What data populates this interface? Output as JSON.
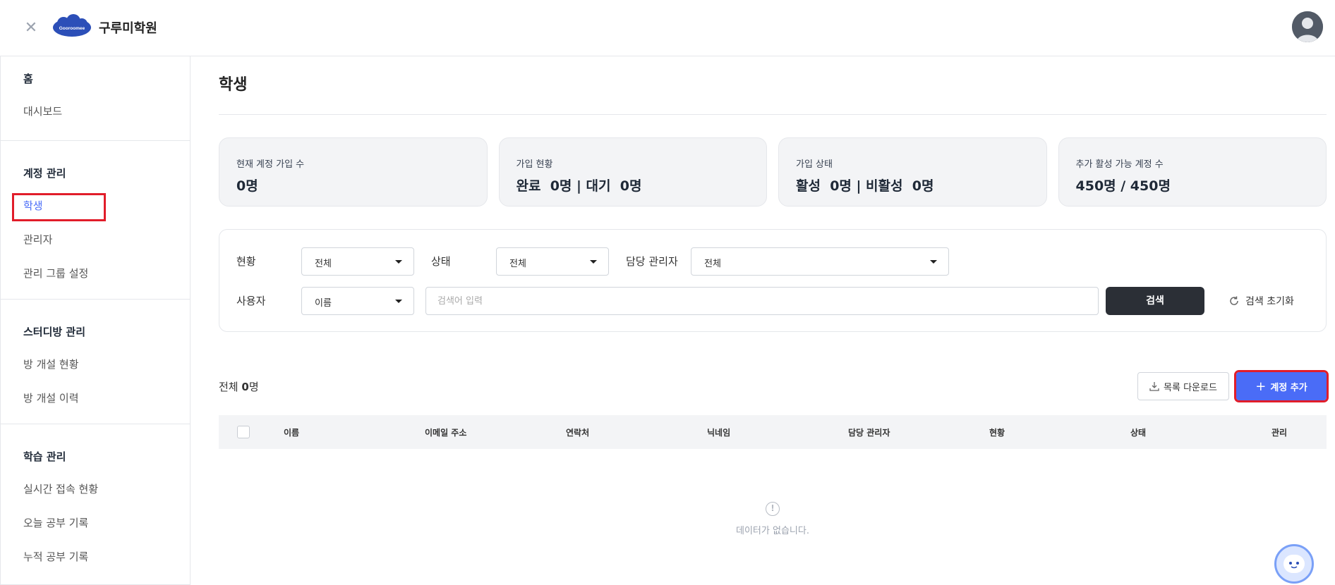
{
  "header": {
    "brand_name": "구루미학원",
    "logo_text": "Gooroomee"
  },
  "sidebar": {
    "sections": [
      {
        "heading": "홈",
        "items": [
          "대시보드"
        ]
      },
      {
        "heading": "계정 관리",
        "items": [
          "학생",
          "관리자",
          "관리 그룹 설정"
        ]
      },
      {
        "heading": "스터디방 관리",
        "items": [
          "방 개설 현황",
          "방 개설 이력"
        ]
      },
      {
        "heading": "학습 관리",
        "items": [
          "실시간 접속 현황",
          "오늘 공부 기록",
          "누적 공부 기록"
        ]
      }
    ],
    "active_item": "학생"
  },
  "page": {
    "title": "학생"
  },
  "stats": [
    {
      "label": "현재 계정 가입 수",
      "value": "0명"
    },
    {
      "label": "가입 현황",
      "value": "완료  0명 | 대기  0명"
    },
    {
      "label": "가입 상태",
      "value": "활성  0명 | 비활성  0명"
    },
    {
      "label": "추가 활성 가능 계정 수",
      "value": "450명 / 450명"
    }
  ],
  "filters": {
    "status_label": "현황",
    "status_value": "전체",
    "state_label": "상태",
    "state_value": "전체",
    "manager_label": "담당 관리자",
    "manager_value": "전체",
    "user_label": "사용자",
    "user_field_value": "이름",
    "search_placeholder": "검색어 입력",
    "search_button": "검색",
    "reset_button": "검색 초기화"
  },
  "list": {
    "total_prefix": "전체",
    "total_count": "0",
    "total_suffix": "명",
    "download_button": "목록 다운로드",
    "add_button": "계정 추가"
  },
  "table": {
    "columns": [
      "이름",
      "이메일 주소",
      "연락처",
      "닉네임",
      "담당 관리자",
      "현황",
      "상태",
      "관리"
    ],
    "empty_text": "데이터가 없습니다."
  }
}
